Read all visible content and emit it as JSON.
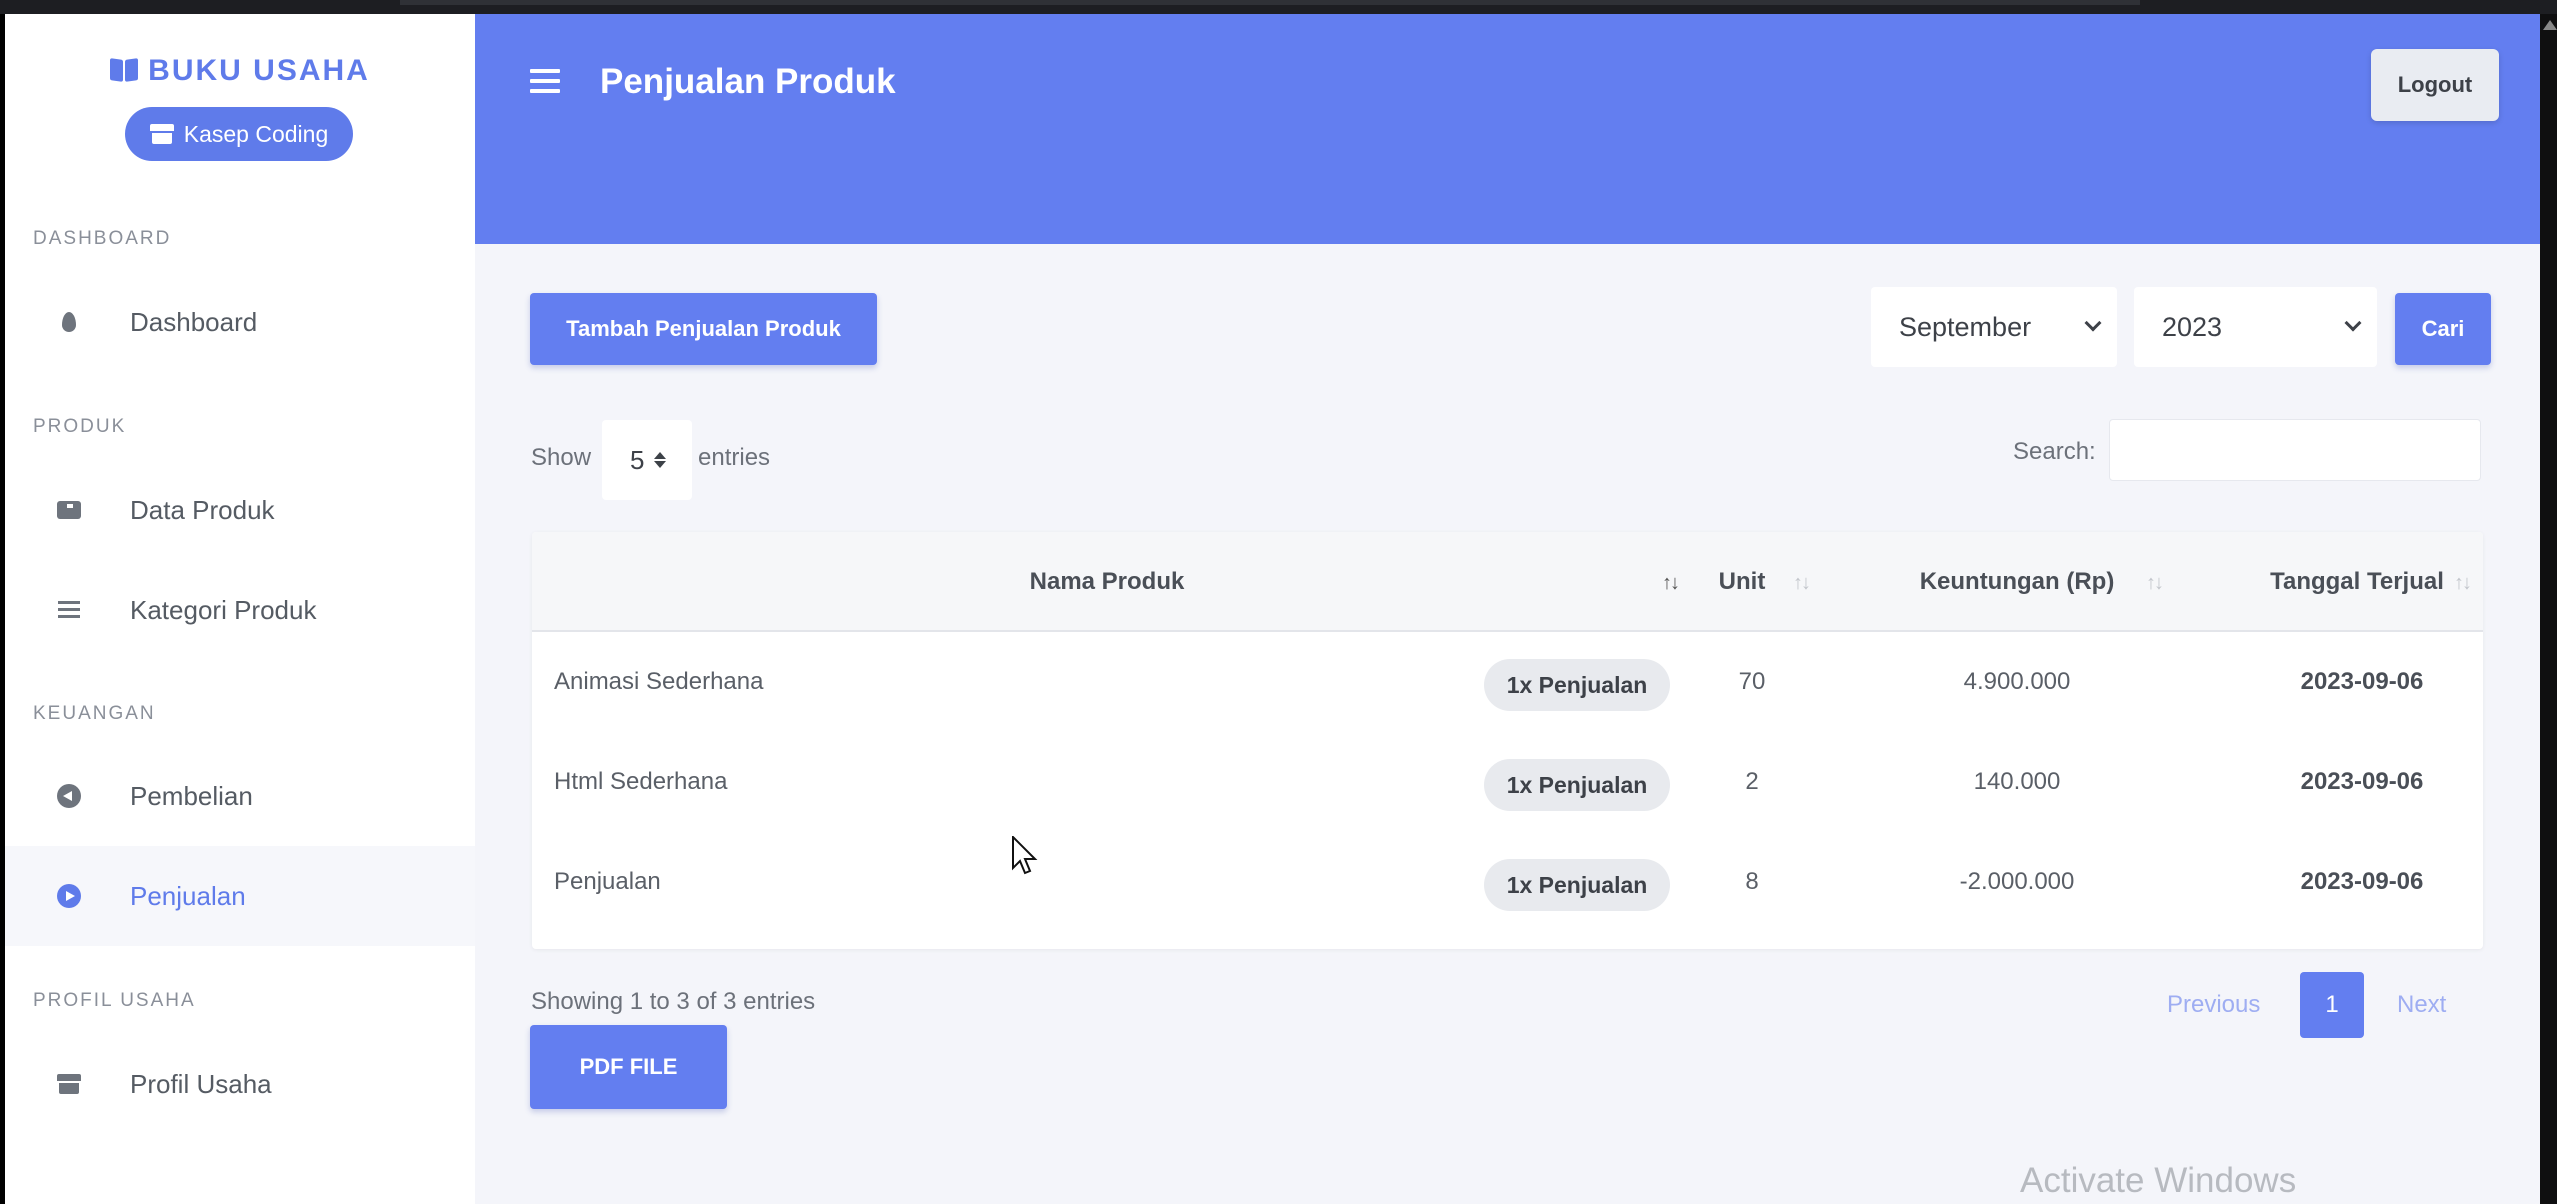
{
  "brand": {
    "name": "BUKU USAHA",
    "shop": "Kasep Coding",
    "accent": "#5f7bea"
  },
  "sidebar": {
    "sections": [
      {
        "label": "DASHBOARD",
        "items": [
          {
            "label": "Dashboard",
            "icon": "fire-icon"
          }
        ]
      },
      {
        "label": "PRODUK",
        "items": [
          {
            "label": "Data Produk",
            "icon": "box-icon"
          },
          {
            "label": "Kategori Produk",
            "icon": "list-icon"
          }
        ]
      },
      {
        "label": "KEUANGAN",
        "items": [
          {
            "label": "Pembelian",
            "icon": "arrow-circle-left-icon"
          },
          {
            "label": "Penjualan",
            "icon": "arrow-circle-right-icon",
            "active": true
          }
        ]
      },
      {
        "label": "PROFIL USAHA",
        "items": [
          {
            "label": "Profil Usaha",
            "icon": "store-icon"
          }
        ]
      }
    ]
  },
  "header": {
    "title": "Penjualan Produk",
    "logout_label": "Logout",
    "color": "#637ef0"
  },
  "toolbar": {
    "add_label": "Tambah Penjualan Produk",
    "month": "September",
    "year": "2023",
    "search_label": "Cari"
  },
  "table_controls": {
    "show_label": "Show",
    "entries_value": "5",
    "entries_label": "entries",
    "search_label": "Search:"
  },
  "table": {
    "columns": [
      "Nama Produk",
      "Unit",
      "Keuntungan (Rp)",
      "Tanggal Terjual"
    ],
    "rows": [
      {
        "name": "Animasi Sederhana",
        "badge": "1x Penjualan",
        "unit": "70",
        "profit": "4.900.000",
        "date": "2023-09-06"
      },
      {
        "name": "Html Sederhana",
        "badge": "1x Penjualan",
        "unit": "2",
        "profit": "140.000",
        "date": "2023-09-06"
      },
      {
        "name": "Penjualan",
        "badge": "1x Penjualan",
        "unit": "8",
        "profit": "-2.000.000",
        "date": "2023-09-06"
      }
    ]
  },
  "footer": {
    "info": "Showing 1 to 3 of 3 entries",
    "prev": "Previous",
    "page": "1",
    "next": "Next",
    "pdf_label": "PDF FILE"
  },
  "os": {
    "watermark": "Activate Windows"
  }
}
